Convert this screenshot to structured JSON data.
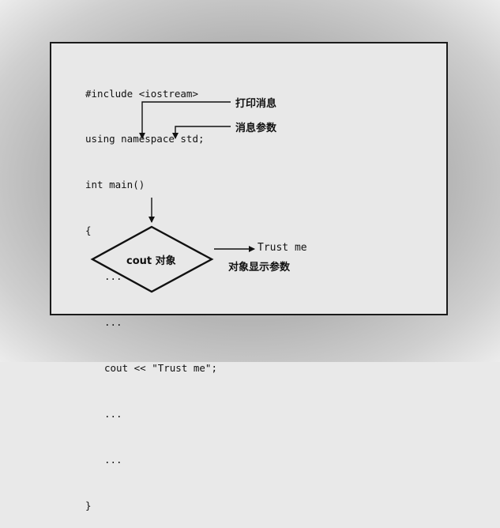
{
  "code": {
    "lines": [
      "#include <iostream>",
      "using namespace std;",
      "int main()",
      "{",
      "...",
      "...",
      "cout << \"Trust me\";",
      "...",
      "...",
      "}"
    ]
  },
  "annotations": {
    "print_message": "打印消息",
    "message_argument": "消息参数"
  },
  "diamond": {
    "label": "cout 对象"
  },
  "output": {
    "text": "Trust me",
    "caption": "对象显示参数"
  }
}
